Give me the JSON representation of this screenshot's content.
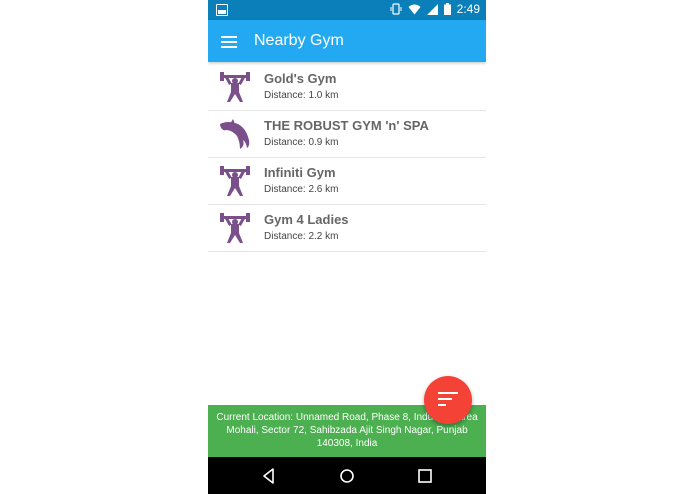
{
  "status_bar": {
    "time": "2:49"
  },
  "app_bar": {
    "title": "Nearby Gym"
  },
  "gyms": [
    {
      "name": "Gold's Gym",
      "distance": "Distance: 1.0 km",
      "icon": "weightlifter-icon"
    },
    {
      "name": "THE ROBUST GYM 'n' SPA",
      "distance": "Distance: 0.9 km",
      "icon": "dolphin-icon"
    },
    {
      "name": "Infiniti Gym",
      "distance": "Distance: 2.6 km",
      "icon": "weightlifter-icon"
    },
    {
      "name": "Gym 4 Ladies",
      "distance": "Distance: 2.2 km",
      "icon": "weightlifter-icon"
    }
  ],
  "current_location": "Current Location: Unnamed Road, Phase 8, Industrial Area Mohali, Sector 72, Sahibzada Ajit Singh Nagar, Punjab 140308, India",
  "colors": {
    "status_bar": "#0b7fb9",
    "app_bar": "#23a9f2",
    "fab": "#f44336",
    "location_bar": "#4caf50",
    "icon_purple": "#7a4f8a"
  }
}
